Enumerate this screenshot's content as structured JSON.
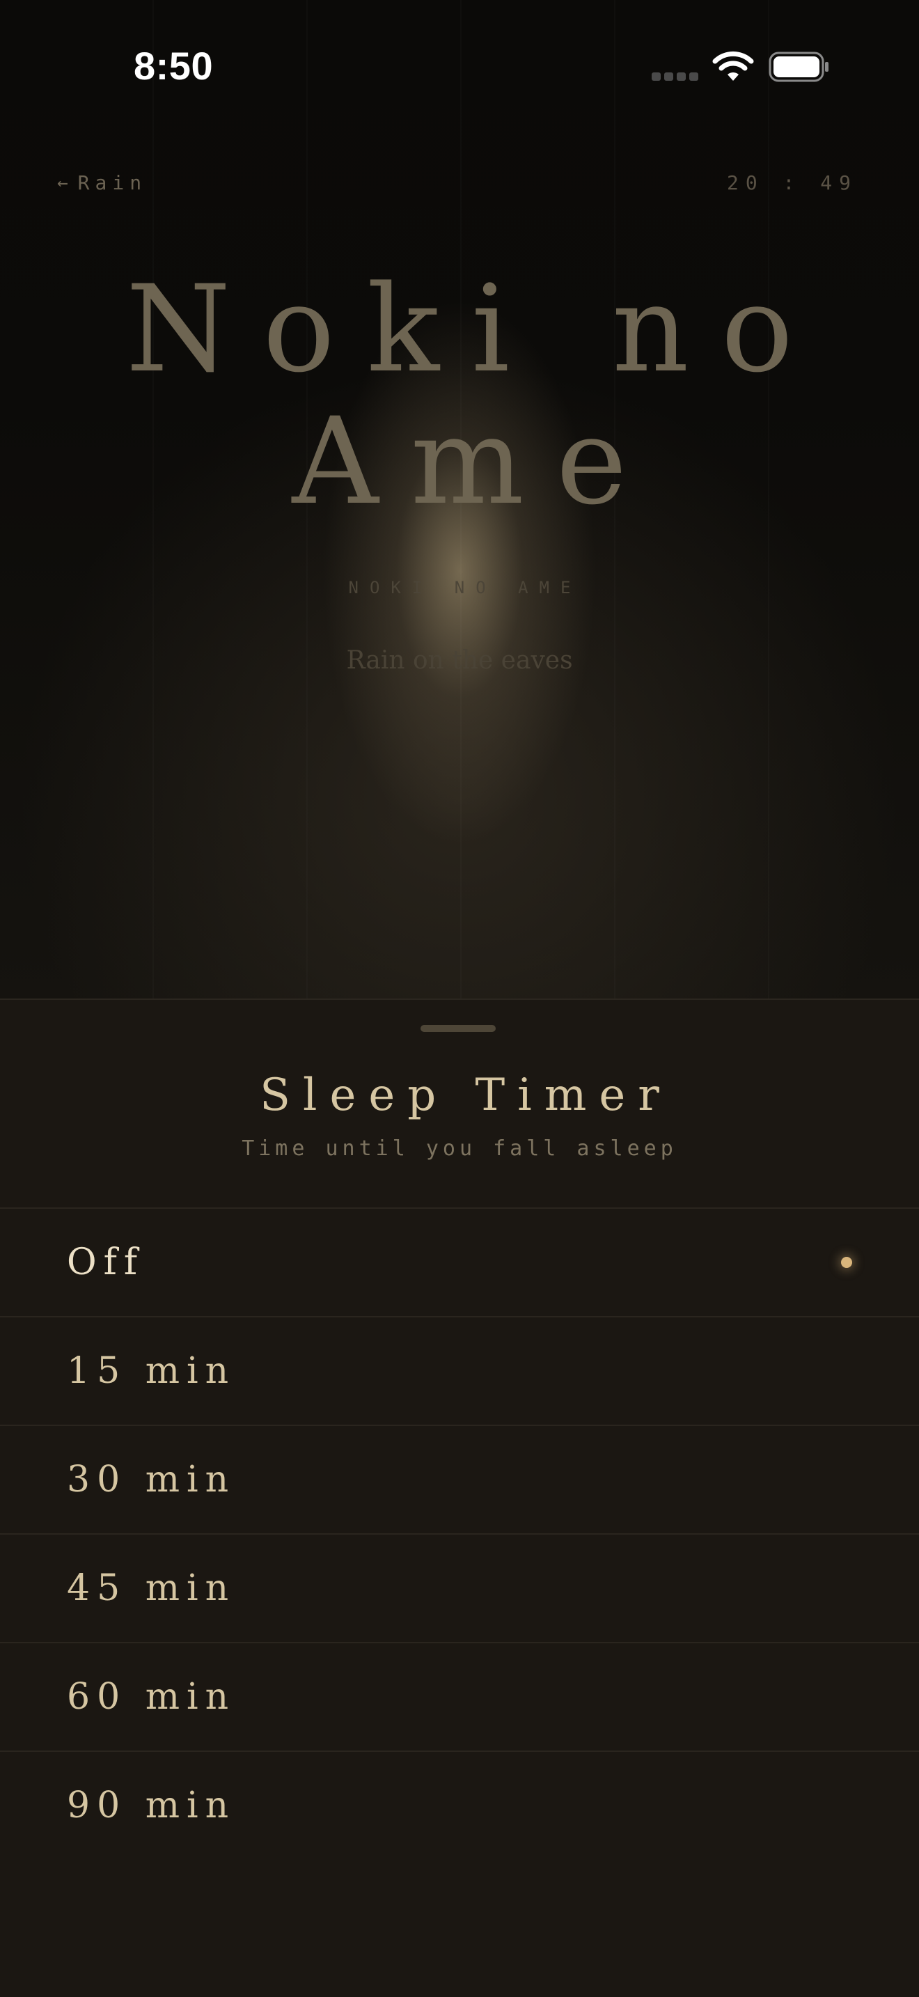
{
  "status_bar": {
    "time": "8:50"
  },
  "nav": {
    "back_label": "Rain",
    "clock": "20 : 49"
  },
  "hero": {
    "title_line1": "Noki no",
    "title_line2": "Ame",
    "romaji": "NOKI NO AME",
    "description": "Rain on the eaves"
  },
  "sheet": {
    "title": "Sleep Timer",
    "subtitle": "Time until you fall asleep",
    "options": [
      {
        "label": "Off",
        "selected": true
      },
      {
        "label": "15 min",
        "selected": false
      },
      {
        "label": "30 min",
        "selected": false
      },
      {
        "label": "45 min",
        "selected": false
      },
      {
        "label": "60 min",
        "selected": false
      },
      {
        "label": "90 min",
        "selected": false
      }
    ]
  },
  "colors": {
    "accent": "#d9b57c",
    "sheet_bg": "#1b1712",
    "text_primary": "#d6c6a2"
  }
}
